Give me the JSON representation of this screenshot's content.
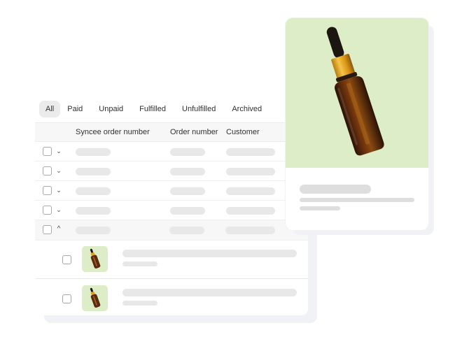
{
  "tabs": [
    {
      "label": "All",
      "active": true
    },
    {
      "label": "Paid",
      "active": false
    },
    {
      "label": "Unpaid",
      "active": false
    },
    {
      "label": "Fulfilled",
      "active": false
    },
    {
      "label": "Unfulfilled",
      "active": false
    },
    {
      "label": "Archived",
      "active": false
    }
  ],
  "table": {
    "columns": [
      "Syncee order number",
      "Order number",
      "Customer"
    ],
    "rows": [
      {
        "expanded": false,
        "chevron": "chevron-down-icon"
      },
      {
        "expanded": false,
        "chevron": "chevron-down-icon"
      },
      {
        "expanded": false,
        "chevron": "chevron-down-icon"
      },
      {
        "expanded": false,
        "chevron": "chevron-down-icon"
      },
      {
        "expanded": true,
        "chevron": "chevron-up-icon"
      }
    ],
    "line_items": [
      {
        "thumbnail": "serum-bottle-image"
      },
      {
        "thumbnail": "serum-bottle-image"
      }
    ]
  },
  "icons": {
    "chevron_down": "⌄",
    "chevron_up": "^"
  },
  "product_card": {
    "image": "amber-dropper-bottle",
    "image_bg": "#dcedc8"
  },
  "colors": {
    "tab_active_bg": "#ebebeb",
    "header_bg": "#f7f7f7",
    "skeleton": "#e8e8e8",
    "product_bg": "#dcedc8",
    "amber": "#5a2a0c",
    "gold": "#e0a020"
  }
}
